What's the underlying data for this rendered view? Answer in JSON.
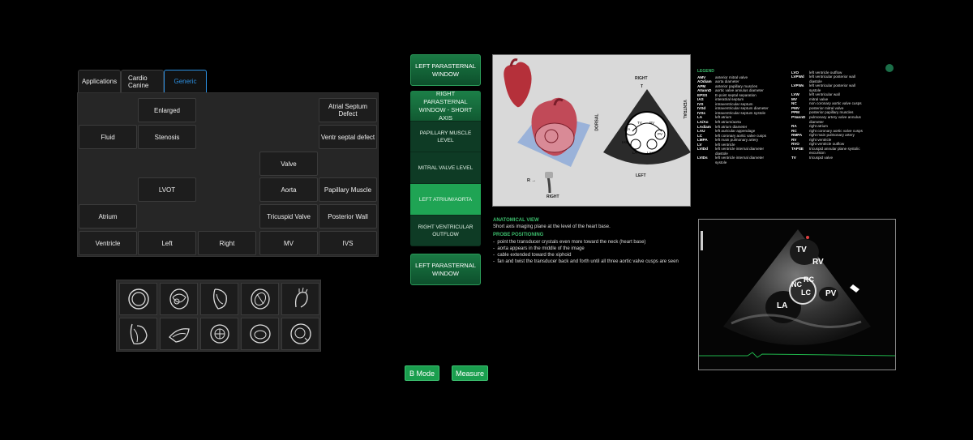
{
  "tabs": [
    {
      "label": "Applications"
    },
    {
      "label": "Cardio Canine"
    },
    {
      "label": "Generic"
    }
  ],
  "grid": {
    "enlarged": "Enlarged",
    "atrial_septum_defect": "Atrial Septum Defect",
    "fluid": "Fluid",
    "stenosis": "Stenosis",
    "ventr_septal_defect": "Ventr septal defect",
    "valve": "Valve",
    "lvot": "LVOT",
    "aorta": "Aorta",
    "papillary_muscle": "Papillary Muscle",
    "atrium": "Atrium",
    "tricuspid_valve": "Tricuspid Valve",
    "posterior_wall": "Posterior Wall",
    "ventricle": "Ventricle",
    "left": "Left",
    "right": "Right",
    "mv": "MV",
    "ivs": "IVS"
  },
  "nav": {
    "top": "LEFT PARASTERNAL WINDOW",
    "active_header": "RIGHT PARASTERNAL WINDOW - SHORT AXIS",
    "items": [
      {
        "label": "PAPILLARY MUSCLE LEVEL"
      },
      {
        "label": "MITRAL VALVE LEVEL"
      },
      {
        "label": "LEFT ATRIUM/AORTA"
      },
      {
        "label": "RIGHT VENTRICULAR OUTFLOW"
      }
    ],
    "bottom": "LEFT PARASTERNAL WINDOW"
  },
  "diagram": {
    "right_top": "RIGHT",
    "t": "T",
    "dorsal": "DORSAL",
    "ventral": "VENTRAL",
    "left_bottom": "LEFT",
    "r_arrow": "R →",
    "right_bottom": "RIGHT",
    "labels": {
      "tv": "TV",
      "rv": "RV",
      "ra": "RA",
      "ias": "IAS",
      "pv": "PV",
      "la": "LA",
      "lau": "LAU"
    }
  },
  "legend": {
    "title": "LEGEND",
    "col1": [
      {
        "k": "AMV",
        "v": "anterior mitral valve"
      },
      {
        "k": "AOdiam",
        "v": "aorta diameter"
      },
      {
        "k": "APM",
        "v": "anterior papillary muscles"
      },
      {
        "k": "AVannD",
        "v": "aortic valve annulus diameter"
      },
      {
        "k": "EPSS",
        "v": "E-point septal separation"
      },
      {
        "k": "IAS",
        "v": "interatrial septum"
      },
      {
        "k": "IVS",
        "v": "intraventricular septum"
      },
      {
        "k": "IVSd",
        "v": "intraventricular septum diameter"
      },
      {
        "k": "IVSs",
        "v": "intraventricular septum systole"
      },
      {
        "k": "LA",
        "v": "left atrium"
      },
      {
        "k": "LA/Ao",
        "v": "left atrium/aorta"
      },
      {
        "k": "LAdiam",
        "v": "left atrium diameter"
      },
      {
        "k": "LAU",
        "v": "left auricular appendage"
      },
      {
        "k": "LC",
        "v": "left coronary aortic valve cusps"
      },
      {
        "k": "LMPA",
        "v": "left main pulmonary artery"
      },
      {
        "k": "LV",
        "v": "left ventricle"
      },
      {
        "k": "LVIDd",
        "v": "left ventricle internal diameter"
      },
      {
        "k": "",
        "v": "diastole"
      },
      {
        "k": "LVIDs",
        "v": "left ventricle internal diameter"
      },
      {
        "k": "",
        "v": "systole"
      }
    ],
    "col2": [
      {
        "k": "LVO",
        "v": "left ventricle outflow"
      },
      {
        "k": "LVPWd",
        "v": "left ventricular posterior wall"
      },
      {
        "k": "",
        "v": "diastole"
      },
      {
        "k": "LVPWs",
        "v": "left ventricular posterior wall"
      },
      {
        "k": "",
        "v": "systole"
      },
      {
        "k": "LVW",
        "v": "left ventricular wall"
      },
      {
        "k": "MV",
        "v": "mitral valve"
      },
      {
        "k": "NC",
        "v": "non coronary aortic valve cusps"
      },
      {
        "k": "PMV",
        "v": "posterior mitral valve"
      },
      {
        "k": "PPM",
        "v": "posterior papillary muscles"
      },
      {
        "k": "PVannD",
        "v": "pulmonary artery valve annulus"
      },
      {
        "k": "",
        "v": "diameter"
      },
      {
        "k": "RA",
        "v": "right atrium"
      },
      {
        "k": "RC",
        "v": "right coronary aortic valve cusps"
      },
      {
        "k": "RMPA",
        "v": "right main pulmonary artery"
      },
      {
        "k": "RV",
        "v": "right ventricle"
      },
      {
        "k": "RVO",
        "v": "right ventricle outflow"
      },
      {
        "k": "TAPSE",
        "v": "tricuspid annular plane systolic"
      },
      {
        "k": "",
        "v": "excursion"
      },
      {
        "k": "TV",
        "v": "tricuspid valve"
      }
    ]
  },
  "info": {
    "anatomical_title": "ANATOMICAL VIEW",
    "anatomical_text": "Short axis imaging plane at the level of the heart base.",
    "probe_title": "PROBE POSITIONING",
    "probe_items": [
      "point the transducer crystals even more toward the neck (heart base)",
      "aorta appears in the middle of the image",
      "cable extended toward the xiphoid",
      "fan and twist the transducer back and forth until all three aortic valve cusps are seen"
    ]
  },
  "echo": {
    "tv": "TV",
    "rv": "RV",
    "nc": "NC",
    "rc": "RC",
    "lc": "LC",
    "pv": "PV",
    "la": "LA"
  },
  "buttons": {
    "b_mode": "B Mode",
    "measure": "Measure"
  },
  "colors": {
    "accent_green": "#1a9e4e",
    "tab_active": "#2c8fe0",
    "info_green": "#3cbc6c"
  }
}
